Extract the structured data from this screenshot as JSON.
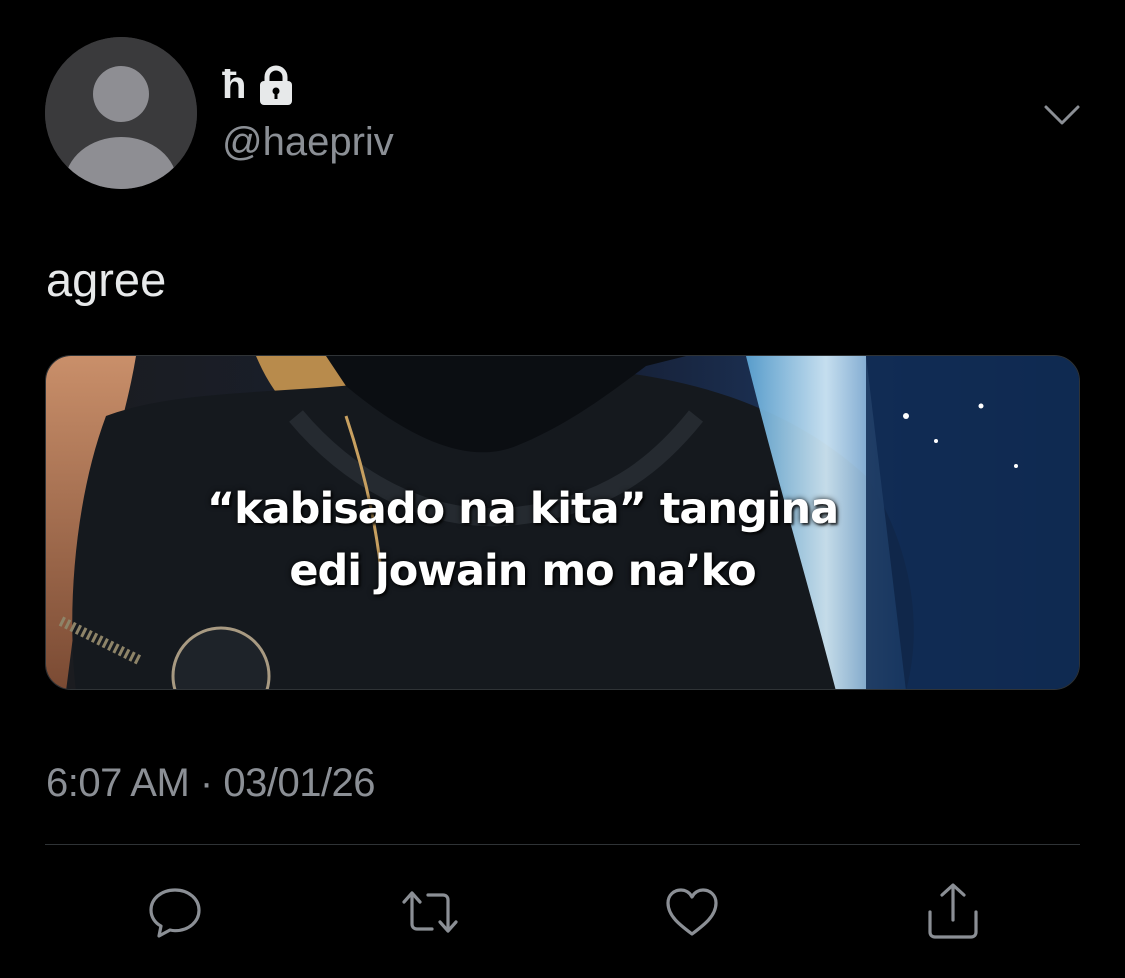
{
  "author": {
    "display_name": "ħ",
    "handle": "@haepriv",
    "avatar_icon": "default-avatar-icon",
    "protected_icon": "lock-icon"
  },
  "header": {
    "more_icon": "chevron-down-icon"
  },
  "tweet": {
    "text": "agree",
    "media": {
      "caption_line1": "“kabisado na kita” tangina",
      "caption_line2": "edi jowain mo na’ko"
    },
    "time": "6:07 AM",
    "separator": "·",
    "date": "03/01/26"
  },
  "actions": [
    {
      "icon": "reply-icon"
    },
    {
      "icon": "retweet-icon"
    },
    {
      "icon": "like-icon"
    },
    {
      "icon": "share-icon"
    }
  ],
  "colors": {
    "background": "#000000",
    "primary_text": "#e7e9ea",
    "secondary_text": "#8b8f95",
    "divider": "#2f3336",
    "icon": "#8b8f95"
  }
}
